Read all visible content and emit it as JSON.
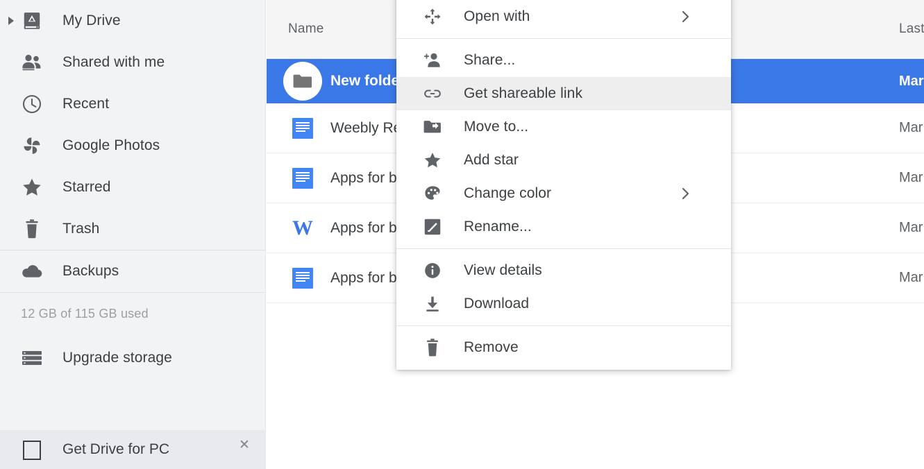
{
  "sidebar": {
    "items": [
      {
        "label": "My Drive",
        "icon": "drive-icon",
        "expandable": true
      },
      {
        "label": "Shared with me",
        "icon": "people-icon",
        "expandable": false
      },
      {
        "label": "Recent",
        "icon": "clock-icon",
        "expandable": false
      },
      {
        "label": "Google Photos",
        "icon": "photos-icon",
        "expandable": false
      },
      {
        "label": "Starred",
        "icon": "star-icon",
        "expandable": false
      },
      {
        "label": "Trash",
        "icon": "trash-icon",
        "expandable": false
      }
    ],
    "backups": {
      "label": "Backups",
      "icon": "cloud-icon"
    },
    "storage_text": "12 GB of 115 GB used",
    "upgrade": {
      "label": "Upgrade storage",
      "icon": "storage-bars-icon"
    },
    "drive_pc_banner": {
      "label": "Get Drive for PC",
      "icon": "monitor-icon",
      "close_icon": "close-icon"
    }
  },
  "filelist": {
    "columns": {
      "name": "Name",
      "last_modified": "Last"
    },
    "rows": [
      {
        "name": "New folder",
        "icon": "folder-icon",
        "date": "Mar",
        "selected": true
      },
      {
        "name": "Weebly Rev",
        "icon": "gdocs-icon",
        "date": "Mar",
        "selected": false
      },
      {
        "name": "Apps for bu",
        "icon": "gdocs-icon",
        "date": "Mar",
        "selected": false
      },
      {
        "name": "Apps for bu",
        "icon": "word-doc-icon",
        "date": "Mar",
        "selected": false
      },
      {
        "name": "Apps for bu",
        "icon": "gdocs-icon",
        "date": "Mar",
        "selected": false
      }
    ]
  },
  "context_menu": {
    "groups": [
      {
        "items": [
          {
            "label": "Open with",
            "icon": "move-arrows-icon",
            "submenu": true,
            "highlight": false
          }
        ]
      },
      {
        "items": [
          {
            "label": "Share...",
            "icon": "person-add-icon",
            "submenu": false,
            "highlight": false
          },
          {
            "label": "Get shareable link",
            "icon": "link-icon",
            "submenu": false,
            "highlight": true
          },
          {
            "label": "Move to...",
            "icon": "folder-move-icon",
            "submenu": false,
            "highlight": false
          },
          {
            "label": "Add star",
            "icon": "star-icon",
            "submenu": false,
            "highlight": false
          },
          {
            "label": "Change color",
            "icon": "palette-icon",
            "submenu": true,
            "highlight": false
          },
          {
            "label": "Rename...",
            "icon": "pencil-icon",
            "submenu": false,
            "highlight": false
          }
        ]
      },
      {
        "items": [
          {
            "label": "View details",
            "icon": "info-icon",
            "submenu": false,
            "highlight": false
          },
          {
            "label": "Download",
            "icon": "download-icon",
            "submenu": false,
            "highlight": false
          }
        ]
      },
      {
        "items": [
          {
            "label": "Remove",
            "icon": "trash-icon",
            "submenu": false,
            "highlight": false
          }
        ]
      }
    ]
  },
  "colors": {
    "selection_blue": "#3b78e7",
    "sidebar_bg": "#f1f3f4",
    "header_bg": "#f5f5f5",
    "icon_gray": "#5f6368",
    "text_dark": "#3c4043",
    "docs_blue": "#4285f4"
  }
}
